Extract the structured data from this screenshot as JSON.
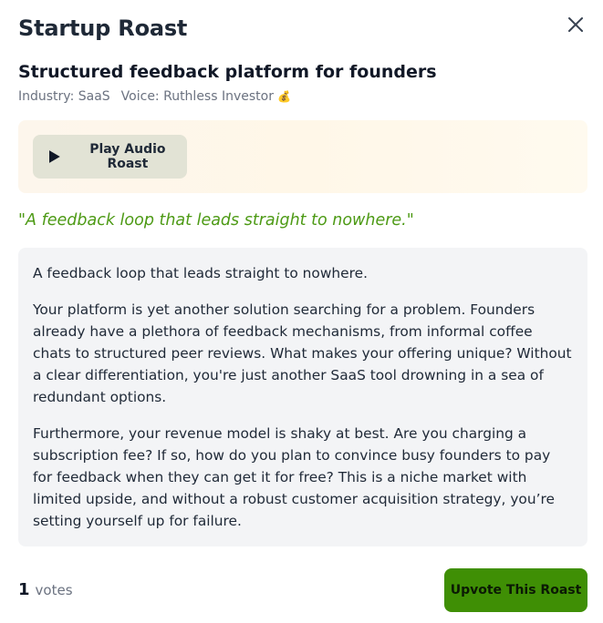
{
  "modal": {
    "title": "Startup Roast",
    "close_icon": "close-icon"
  },
  "roast": {
    "title": "Structured feedback platform for founders",
    "industry_text": "Industry: SaaS",
    "voice_text": "Voice: Ruthless Investor",
    "voice_emoji": "💰",
    "tagline": "\"A feedback loop that leads straight to nowhere.\"",
    "paragraphs": [
      "A feedback loop that leads straight to nowhere.",
      "Your platform is yet another solution searching for a problem. Founders already have a plethora of feedback mechanisms, from informal coffee chats to structured peer reviews. What makes your offering unique? Without a clear differentiation, you're just another SaaS tool drowning in a sea of redundant options.",
      "Furthermore, your revenue model is shaky at best. Are you charging a subscription fee? If so, how do you plan to convince busy founders to pay for feedback when they can get it for free? This is a niche market with limited upside, and without a robust customer acquisition strategy, you’re setting yourself up for failure."
    ]
  },
  "audio": {
    "play_label": "Play Audio Roast",
    "play_icon": "play-icon"
  },
  "footer": {
    "vote_count": "1",
    "votes_word": "votes",
    "upvote_label": "Upvote This Roast"
  },
  "colors": {
    "accent_green": "#3f8f05",
    "tagline_green": "#4d9a15",
    "body_background": "#f3f4f6"
  }
}
